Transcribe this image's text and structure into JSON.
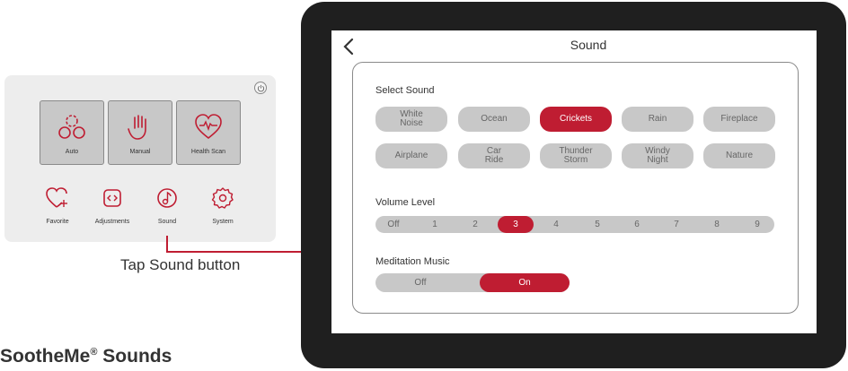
{
  "remote": {
    "tiles": [
      {
        "label": "Auto",
        "icon": "auto-icon"
      },
      {
        "label": "Manual",
        "icon": "hand-icon"
      },
      {
        "label": "Health Scan",
        "icon": "heart-pulse-icon"
      }
    ],
    "minis": [
      {
        "label": "Favorite",
        "icon": "heart-plus-icon"
      },
      {
        "label": "Adjustments",
        "icon": "adjust-icon"
      },
      {
        "label": "Sound",
        "icon": "music-note-icon"
      },
      {
        "label": "System",
        "icon": "gear-icon"
      }
    ]
  },
  "annotation": {
    "tap_note": "Tap Sound button",
    "brand": "SootheMe",
    "brand_mark": "®",
    "brand_suffix": " Sounds"
  },
  "screen": {
    "title": "Sound",
    "select_sound_label": "Select Sound",
    "sounds": [
      {
        "label": "White\nNoise",
        "selected": false
      },
      {
        "label": "Ocean",
        "selected": false
      },
      {
        "label": "Crickets",
        "selected": true
      },
      {
        "label": "Rain",
        "selected": false
      },
      {
        "label": "Fireplace",
        "selected": false
      },
      {
        "label": "Airplane",
        "selected": false
      },
      {
        "label": "Car\nRide",
        "selected": false
      },
      {
        "label": "Thunder\nStorm",
        "selected": false
      },
      {
        "label": "Windy\nNight",
        "selected": false
      },
      {
        "label": "Nature",
        "selected": false
      }
    ],
    "volume_label": "Volume Level",
    "volume_levels": [
      "Off",
      "1",
      "2",
      "3",
      "4",
      "5",
      "6",
      "7",
      "8",
      "9"
    ],
    "volume_selected": "3",
    "meditation_label": "Meditation Music",
    "meditation_options": [
      "Off",
      "On"
    ],
    "meditation_selected": "On"
  },
  "colors": {
    "accent": "#bf1d32",
    "button_gray": "#c8c8c8",
    "tablet_bezel": "#1f1f1f"
  }
}
